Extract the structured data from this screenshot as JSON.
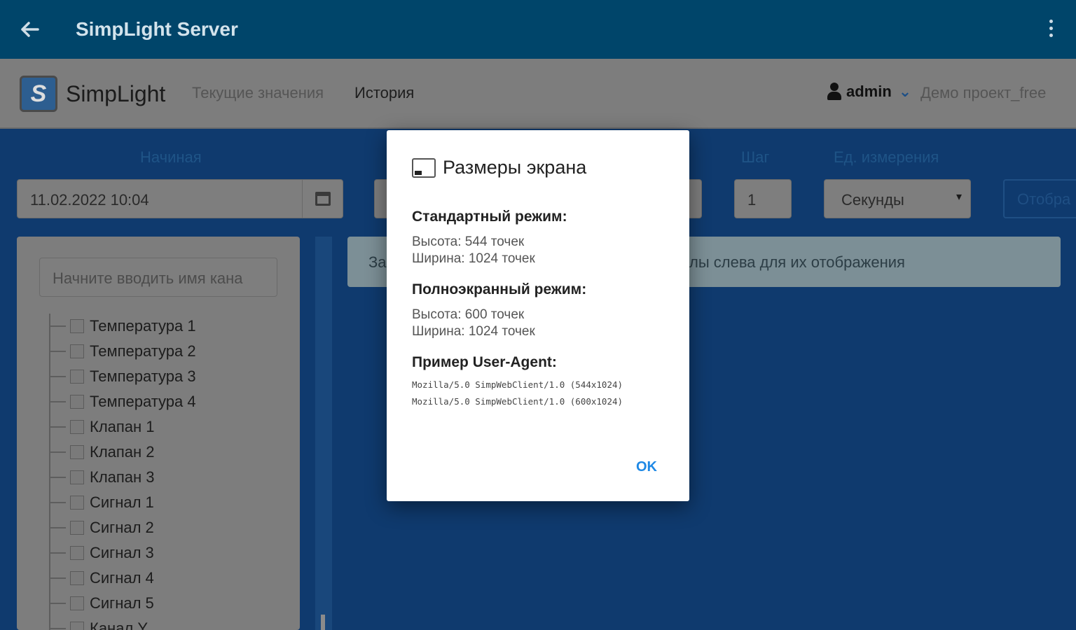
{
  "appbar": {
    "title": "SimpLight Server"
  },
  "navbar": {
    "brand": "SimpLight",
    "current_values": "Текущие значения",
    "history": "История",
    "user": "admin",
    "project": "Демо проект_free"
  },
  "filters": {
    "start_label": "Начиная",
    "start_value": "11.02.2022 10:04",
    "step_label": "Шаг",
    "step_value": "1",
    "unit_label": "Ед. измерения",
    "unit_value": "Секунды",
    "show_button": "Отобра"
  },
  "channels": {
    "search_placeholder": "Начните вводить имя кана",
    "items": [
      "Температура 1",
      "Температура 2",
      "Температура 3",
      "Температура 4",
      "Клапан 1",
      "Клапан 2",
      "Клапан 3",
      "Сигнал 1",
      "Сигнал 2",
      "Сигнал 3",
      "Сигнал 4",
      "Сигнал 5",
      "Канал Y"
    ]
  },
  "info": {
    "left": "За",
    "right": "лы слева для их отображения"
  },
  "dialog": {
    "title": "Размеры экрана",
    "standard_heading": "Стандартный режим:",
    "standard_height": "Высота: 544 точек",
    "standard_width": "Ширина: 1024 точек",
    "fullscreen_heading": "Полноэкранный режим:",
    "fullscreen_height": "Высота: 600 точек",
    "fullscreen_width": "Ширина: 1024 точек",
    "ua_heading": "Пример User-Agent:",
    "ua_1": "Mozilla/5.0 SimpWebClient/1.0 (544x1024)",
    "ua_2": "Mozilla/5.0 SimpWebClient/1.0 (600x1024)",
    "ok": "OK"
  }
}
